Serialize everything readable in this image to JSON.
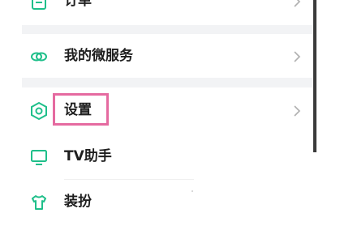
{
  "menu": {
    "items": [
      {
        "id": "orders",
        "label": "订单",
        "icon": "document-list-icon"
      },
      {
        "id": "micro-services",
        "label": "我的微服务",
        "icon": "link-loop-icon"
      },
      {
        "id": "settings",
        "label": "设置",
        "icon": "hexagon-settings-icon"
      },
      {
        "id": "tv-assistant",
        "label": "TV助手",
        "icon": "tv-screen-icon"
      },
      {
        "id": "dress-up",
        "label": "装扮",
        "icon": "tshirt-icon"
      }
    ]
  },
  "colors": {
    "accent": "#1fbf8a",
    "highlight": "#e56aa0",
    "chevron": "#b0b0b0",
    "separator": "#f2f3f5"
  }
}
